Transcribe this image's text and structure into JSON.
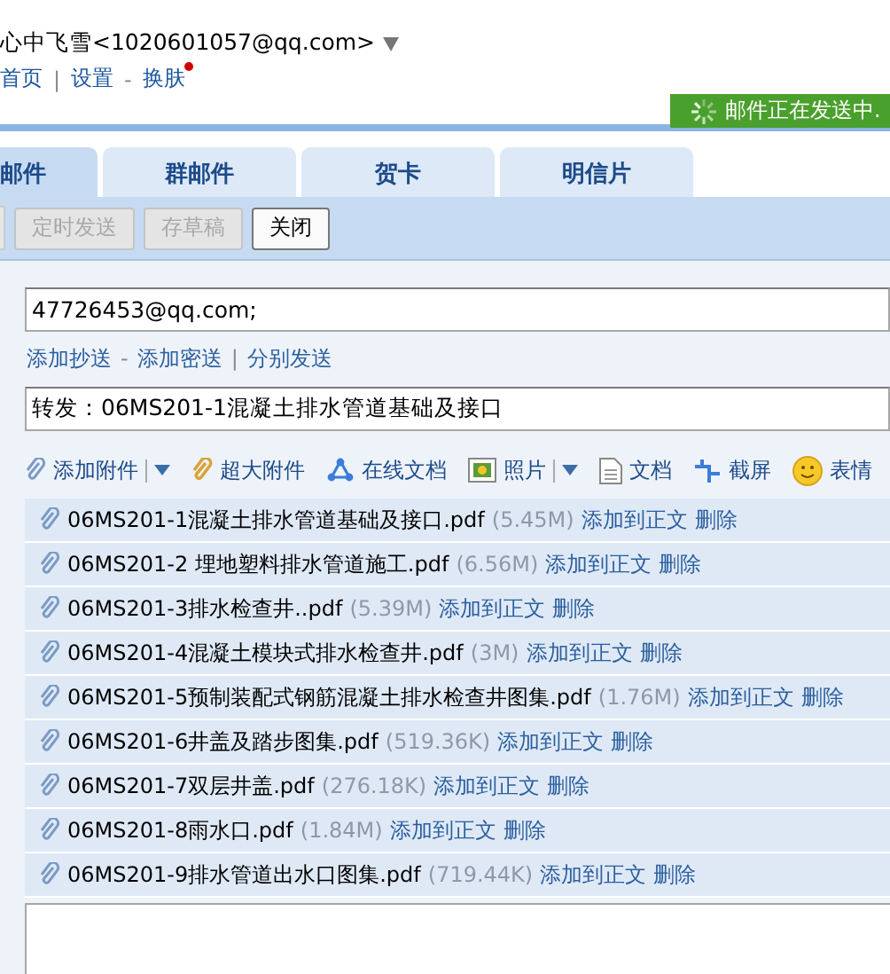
{
  "account": {
    "sender": "心中飞雪<1020601057@qq.com>",
    "links": [
      {
        "label": "首页"
      },
      {
        "separator": "|",
        "label": "设置"
      },
      {
        "separator": "-",
        "label": "换肤",
        "notify": true
      }
    ]
  },
  "status": {
    "text": "邮件正在发送中."
  },
  "tabs": [
    {
      "label": "邮件",
      "selected": true
    },
    {
      "label": "群邮件",
      "selected": false
    },
    {
      "label": "贺卡",
      "selected": false
    },
    {
      "label": "明信片",
      "selected": false
    }
  ],
  "toolbar": [
    {
      "label": "定时发送",
      "disabled": true
    },
    {
      "label": "存草稿",
      "disabled": true
    },
    {
      "label": "关闭",
      "disabled": false
    }
  ],
  "to": {
    "value": "47726453@qq.com;"
  },
  "recipient_links": [
    {
      "label": "添加抄送"
    },
    {
      "separator": "-",
      "label": "添加密送"
    },
    {
      "separator": "|",
      "label": "分别发送"
    }
  ],
  "subject": {
    "value": "转发：06MS201-1混凝土排水管道基础及接口"
  },
  "attach_tools": [
    {
      "kind": "clip",
      "label": "添加附件",
      "dropdown": true
    },
    {
      "kind": "bigclip",
      "label": "超大附件",
      "dropdown": false
    },
    {
      "kind": "share",
      "label": "在线文档",
      "dropdown": false
    },
    {
      "kind": "photo",
      "label": "照片",
      "dropdown": true
    },
    {
      "kind": "doc",
      "label": "文档",
      "dropdown": false
    },
    {
      "kind": "cut",
      "label": "截屏",
      "dropdown": false
    },
    {
      "kind": "smile",
      "label": "表情",
      "dropdown": false
    }
  ],
  "attachments": [
    {
      "name": "06MS201-1混凝土排水管道基础及接口.pdf",
      "size": "(5.45M)",
      "insert": "添加到正文",
      "delete": "删除"
    },
    {
      "name": "06MS201-2 埋地塑料排水管道施工.pdf",
      "size": "(6.56M)",
      "insert": "添加到正文",
      "delete": "删除"
    },
    {
      "name": "06MS201-3排水检查井..pdf",
      "size": "(5.39M)",
      "insert": "添加到正文",
      "delete": "删除"
    },
    {
      "name": "06MS201-4混凝土模块式排水检查井.pdf",
      "size": "(3M)",
      "insert": "添加到正文",
      "delete": "删除"
    },
    {
      "name": "06MS201-5预制装配式钢筋混凝土排水检查井图集.pdf",
      "size": "(1.76M)",
      "insert": "添加到正文",
      "delete": "删除"
    },
    {
      "name": "06MS201-6井盖及踏步图集.pdf",
      "size": "(519.36K)",
      "insert": "添加到正文",
      "delete": "删除"
    },
    {
      "name": "06MS201-7双层井盖.pdf",
      "size": "(276.18K)",
      "insert": "添加到正文",
      "delete": "删除"
    },
    {
      "name": "06MS201-8雨水口.pdf",
      "size": "(1.84M)",
      "insert": "添加到正文",
      "delete": "删除"
    },
    {
      "name": "06MS201-9排水管道出水口图集.pdf",
      "size": "(719.44K)",
      "insert": "添加到正文",
      "delete": "删除"
    }
  ]
}
